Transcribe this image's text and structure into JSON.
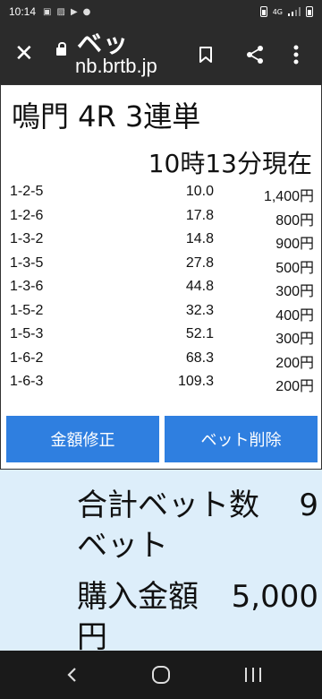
{
  "status_bar": {
    "time": "10:14",
    "icons": [
      "message-icon",
      "image-icon",
      "play-icon",
      "dot-icon"
    ],
    "right_icons": [
      "battery-icon",
      "4g-icon",
      "signal-icon",
      "battery-level-icon"
    ],
    "network": "4G"
  },
  "browser": {
    "close_label": "✕",
    "page_title": "ベッ",
    "domain": "nb.brtb.jp"
  },
  "race": {
    "title": "鳴門 4R 3連単",
    "update_time": "10時13分現在"
  },
  "bets": [
    {
      "combo": "1-2-5",
      "odds": "10.0",
      "amount": "1,400円"
    },
    {
      "combo": "1-2-6",
      "odds": "17.8",
      "amount": "800円"
    },
    {
      "combo": "1-3-2",
      "odds": "14.8",
      "amount": "900円"
    },
    {
      "combo": "1-3-5",
      "odds": "27.8",
      "amount": "500円"
    },
    {
      "combo": "1-3-6",
      "odds": "44.8",
      "amount": "300円"
    },
    {
      "combo": "1-5-2",
      "odds": "32.3",
      "amount": "400円"
    },
    {
      "combo": "1-5-3",
      "odds": "52.1",
      "amount": "300円"
    },
    {
      "combo": "1-6-2",
      "odds": "68.3",
      "amount": "200円"
    },
    {
      "combo": "1-6-3",
      "odds": "109.3",
      "amount": "200円"
    }
  ],
  "buttons": {
    "edit_amount": "金額修正",
    "delete_bet": "ベット削除"
  },
  "summary": {
    "total_bets_label": "合計ベット数",
    "total_bets_value": "9",
    "total_bets_unit": "ベット",
    "purchase_label": "購入金額",
    "purchase_value": "5,000",
    "purchase_unit": "円"
  },
  "colors": {
    "button_blue": "#2f7fe0",
    "toolbar_dark": "#2b2b2b",
    "summary_bg": "#ddeefa"
  }
}
